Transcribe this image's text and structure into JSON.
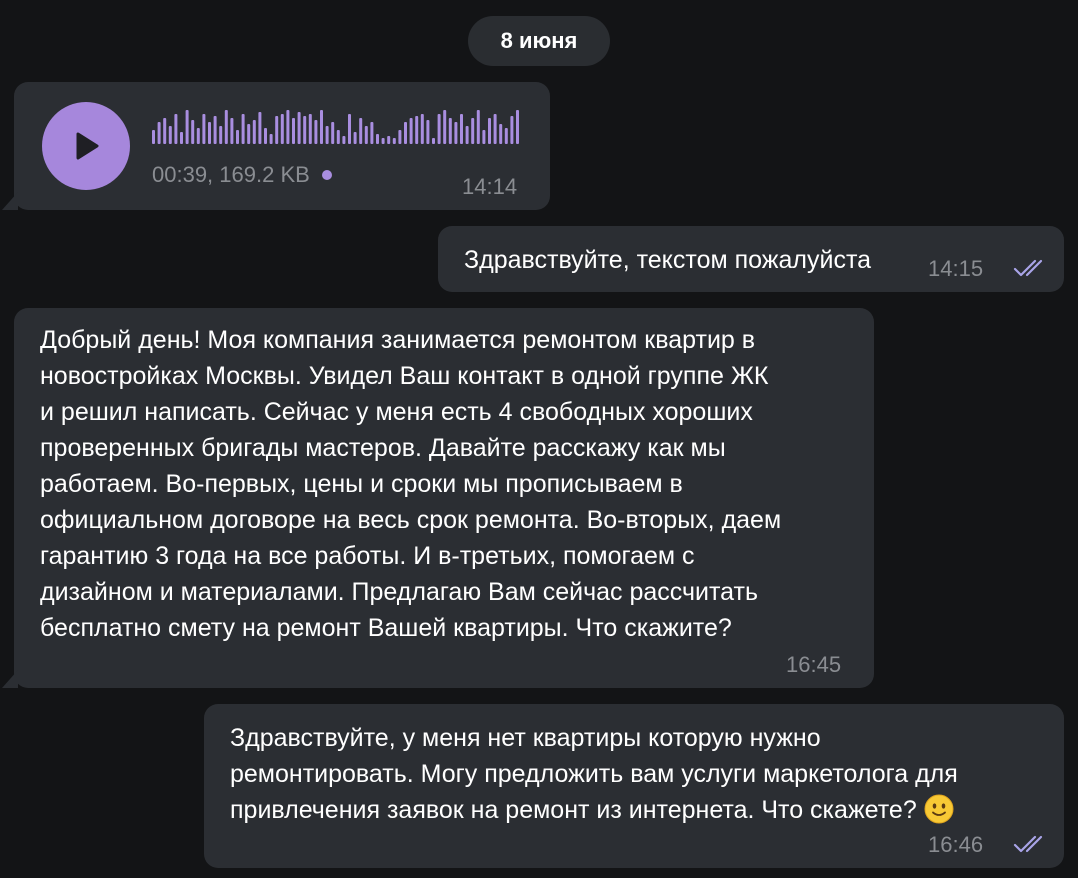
{
  "date_separator": "8 июня",
  "messages": [
    {
      "type": "voice",
      "direction": "incoming",
      "duration": "00:39",
      "size": "169.2 KB",
      "meta": "00:39, 169.2 KB",
      "time": "14:14",
      "unread": true
    },
    {
      "type": "text",
      "direction": "outgoing",
      "text": "Здравствуйте, текстом пожалуйста",
      "time": "14:15",
      "status": "read"
    },
    {
      "type": "text",
      "direction": "incoming",
      "text": "Добрый день! Моя компания занимается ремонтом квартир в\nновостройках Москвы. Увидел Ваш контакт в одной группе ЖК\nи решил написать. Сейчас у меня есть 4 свободных хороших\nпроверенных бригады мастеров. Давайте расскажу как мы\nработаем. Во-первых, цены и сроки мы прописываем в\nофициальном договоре на весь срок ремонта. Во-вторых, даем\nгарантию 3 года на все работы. И в-третьих, помогаем с\nдизайном и материалами. Предлагаю Вам сейчас рассчитать\nбесплатно смету на ремонт Вашей квартиры. Что скажите?",
      "time": "16:45"
    },
    {
      "type": "text",
      "direction": "outgoing",
      "text": "Здравствуйте, у меня нет квартиры которую нужно\nремонтировать. Могу предложить вам услуги маркетолога для\nпривлечения заявок на ремонт из интернета. Что скажете?",
      "time": "16:46",
      "status": "read",
      "emoji": "slightly-smiling-face"
    }
  ],
  "colors": {
    "background": "#131416",
    "bubble": "#2b2e33",
    "accent": "#a687dc",
    "checks": "#a9a4e8",
    "meta_text": "#8a8d92"
  },
  "icons": {
    "play": "play-icon",
    "waveform": "waveform-icon",
    "read_receipt": "double-check-icon",
    "emoji": "slightly-smiling-face-emoji-icon"
  }
}
